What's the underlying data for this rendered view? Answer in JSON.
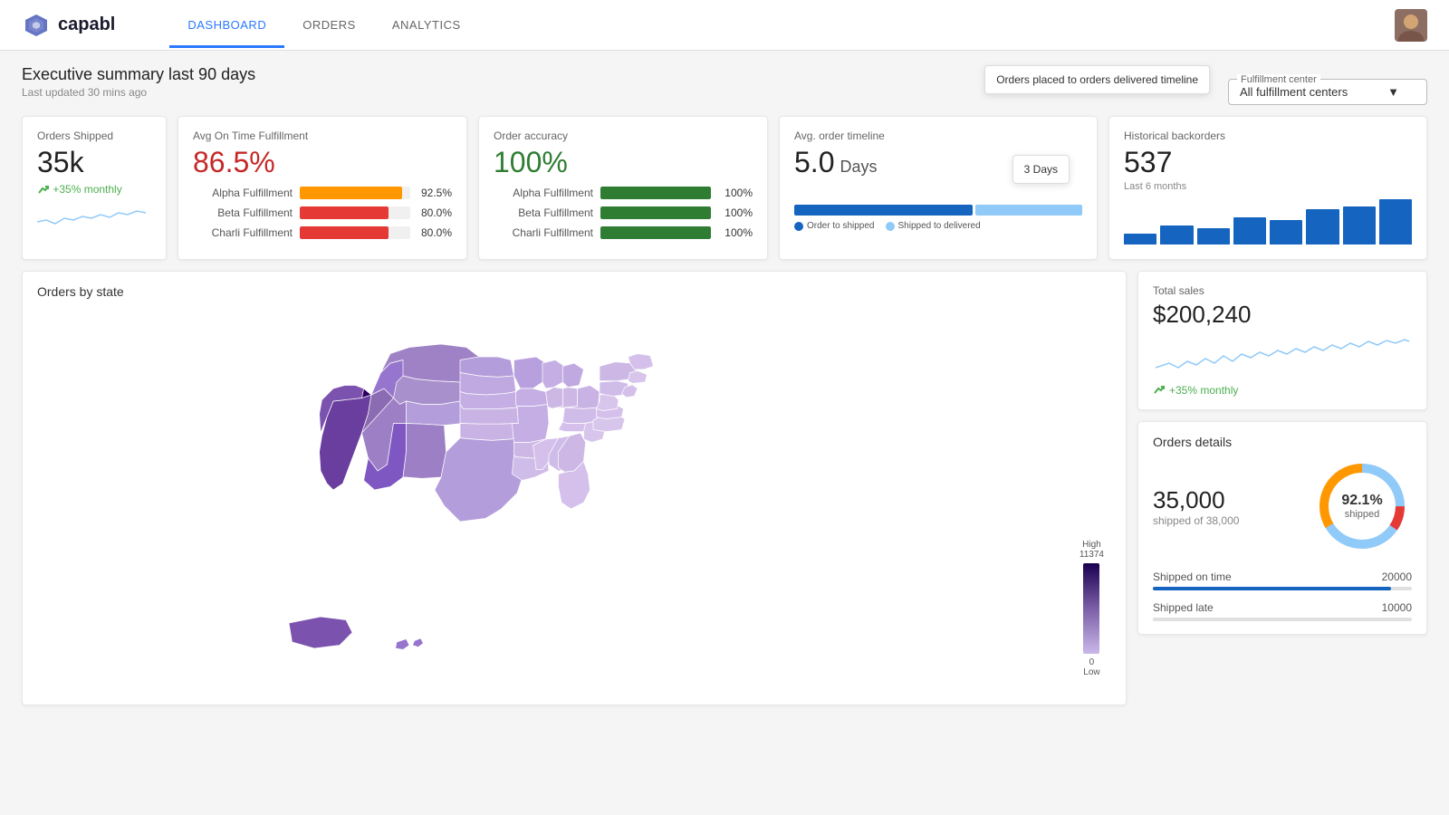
{
  "app": {
    "name": "capabl",
    "logo_alt": "capabl logo"
  },
  "nav": {
    "items": [
      {
        "label": "DASHBOARD",
        "active": true
      },
      {
        "label": "ORDERS",
        "active": false
      },
      {
        "label": "ANALYTICS",
        "active": false
      }
    ]
  },
  "header": {
    "fulfillment_center_label": "Fulfillment center",
    "fulfillment_center_value": "All fulfillment centers"
  },
  "summary": {
    "title": "Executive summary last 90 days",
    "subtitle": "Last updated 30 mins ago"
  },
  "kpis": {
    "orders_shipped": {
      "label": "Orders Shipped",
      "value": "35k",
      "change": "+35% monthly"
    },
    "avg_on_time": {
      "label": "Avg On Time Fulfillment",
      "value": "86.5%",
      "rows": [
        {
          "label": "Alpha Fulfillment",
          "pct": 92.5,
          "pct_label": "92.5%",
          "type": "orange"
        },
        {
          "label": "Beta Fulfillment",
          "pct": 80.0,
          "pct_label": "80.0%",
          "type": "red"
        },
        {
          "label": "Charli Fulfillment",
          "pct": 80.0,
          "pct_label": "80.0%",
          "type": "red"
        }
      ]
    },
    "order_accuracy": {
      "label": "Order accuracy",
      "value": "100%",
      "rows": [
        {
          "label": "Alpha Fulfillment",
          "pct": 100,
          "pct_label": "100%",
          "type": "green"
        },
        {
          "label": "Beta Fulfillment",
          "pct": 100,
          "pct_label": "100%",
          "type": "green"
        },
        {
          "label": "Charli Fulfillment",
          "pct": 100,
          "pct_label": "100%",
          "type": "green"
        }
      ]
    },
    "avg_order_timeline": {
      "label": "Avg. order timeline",
      "value": "5.0",
      "unit": "Days",
      "tooltip": "3 Days",
      "tooltip_sub": "Orders placed to orders delivered timeline",
      "legend": [
        {
          "label": "Order to shipped",
          "color": "#1565c0"
        },
        {
          "label": "Shipped to delivered",
          "color": "#90caf9"
        }
      ]
    },
    "historical_backorders": {
      "label": "Historical backorders",
      "value": "537",
      "subtitle": "Last 6 months",
      "bars": [
        20,
        35,
        30,
        50,
        45,
        65,
        70,
        85
      ]
    }
  },
  "map": {
    "title": "Orders by state",
    "legend_high": "High",
    "legend_value": "11374",
    "legend_low": "0",
    "legend_low_label": "Low"
  },
  "total_sales": {
    "label": "Total sales",
    "value": "$200,240",
    "change": "+35% monthly"
  },
  "orders_details": {
    "label": "Orders details",
    "shipped_count": "35,000",
    "shipped_of": "shipped of 38,000",
    "donut_pct": "92.1%",
    "donut_sub": "shipped",
    "shipped_on_time_label": "Shipped on time",
    "shipped_on_time_value": "20000",
    "shipped_on_time_pct": 92,
    "shipped_late_label": "Shipped late",
    "shipped_late_value": "10000"
  },
  "icons": {
    "chevron_down": "▼",
    "trend_up": "↗"
  }
}
